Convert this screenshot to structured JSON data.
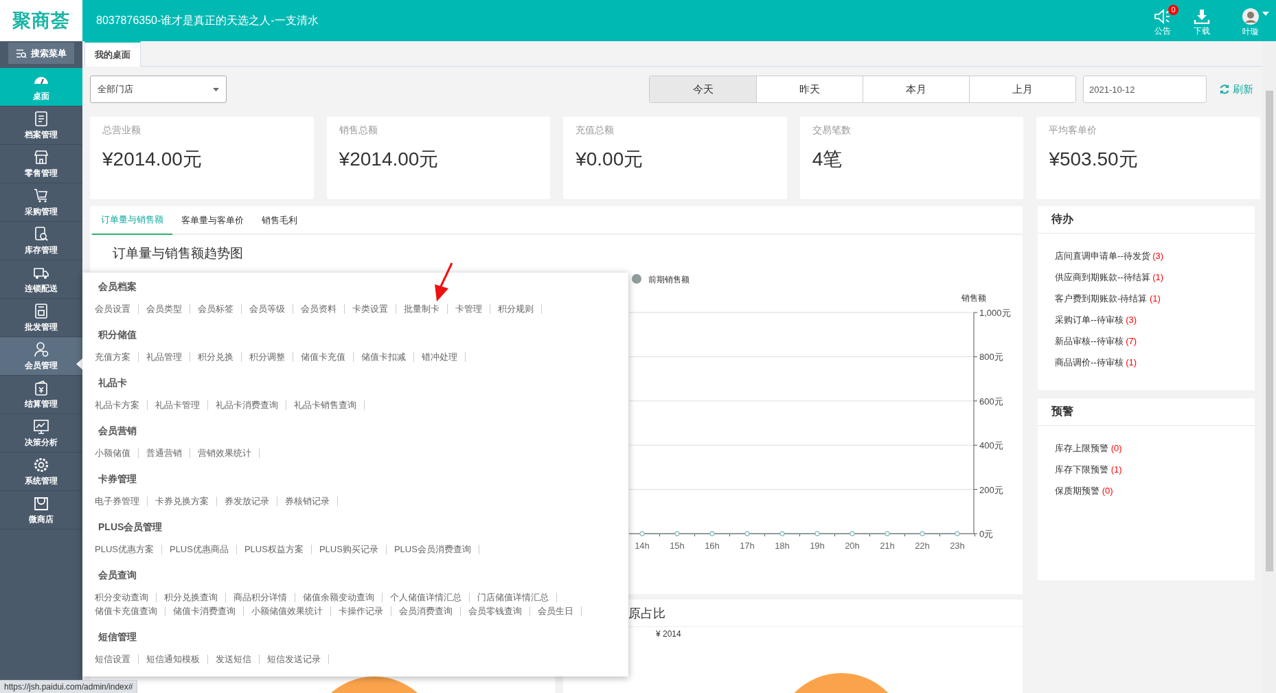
{
  "header": {
    "logo": "聚商荟",
    "title": "8037876350-谁才是真正的天选之人-一支清水",
    "actions": [
      {
        "kind": "notice",
        "label": "公告",
        "badge": "0"
      },
      {
        "kind": "download",
        "label": "下载"
      },
      {
        "kind": "user",
        "label": "叶璇"
      }
    ]
  },
  "sidebar": {
    "search": "搜索菜单",
    "items": [
      {
        "label": "桌面",
        "selected": true,
        "expanded": false
      },
      {
        "label": "档案管理",
        "selected": false,
        "expanded": false
      },
      {
        "label": "零售管理",
        "selected": false,
        "expanded": false
      },
      {
        "label": "采购管理",
        "selected": false,
        "expanded": false
      },
      {
        "label": "库存管理",
        "selected": false,
        "expanded": false
      },
      {
        "label": "连锁配送",
        "selected": false,
        "expanded": false
      },
      {
        "label": "批发管理",
        "selected": false,
        "expanded": false
      },
      {
        "label": "会员管理",
        "selected": false,
        "expanded": true
      },
      {
        "label": "结算管理",
        "selected": false,
        "expanded": false
      },
      {
        "label": "决策分析",
        "selected": false,
        "expanded": false
      },
      {
        "label": "系统管理",
        "selected": false,
        "expanded": false
      },
      {
        "label": "微商店",
        "selected": false,
        "expanded": false
      }
    ]
  },
  "page_tabs": [
    {
      "label": "我的桌面",
      "selected": true
    }
  ],
  "store_select": {
    "value": "全部门店"
  },
  "date_ranges": [
    {
      "label": "今天",
      "selected": true
    },
    {
      "label": "昨天",
      "selected": false
    },
    {
      "label": "本月",
      "selected": false
    },
    {
      "label": "上月",
      "selected": false
    }
  ],
  "date_field": {
    "value": "2021-10-12"
  },
  "refresh": "刷新",
  "stats": [
    {
      "label": "总营业额",
      "value": "¥2014.00元"
    },
    {
      "label": "销售总额",
      "value": "¥2014.00元"
    },
    {
      "label": "充值总额",
      "value": "¥0.00元"
    },
    {
      "label": "交易笔数",
      "value": "4笔"
    },
    {
      "label": "平均客单价",
      "value": "¥503.50元"
    }
  ],
  "chart_panel": {
    "tabs": [
      {
        "label": "订单量与销售额",
        "selected": true
      },
      {
        "label": "客单量与客单价",
        "selected": false
      },
      {
        "label": "销售毛利",
        "selected": false
      }
    ],
    "title": "订单量与销售额趋势图",
    "chart_data": {
      "type": "line",
      "ylabel": "销售额",
      "categories": [
        "14h",
        "15h",
        "16h",
        "17h",
        "18h",
        "19h",
        "20h",
        "21h",
        "22h",
        "23h"
      ],
      "grid": true,
      "series": [
        {
          "name": "前期销售额",
          "color": "#8d9c9c",
          "marker": "circle",
          "values": [
            0,
            0,
            0,
            0,
            0,
            0,
            0,
            0,
            0,
            0
          ]
        }
      ],
      "ylim": [
        0,
        1000
      ],
      "yticks": [
        {
          "value": 0,
          "label": "0元"
        },
        {
          "value": 200,
          "label": "200元"
        },
        {
          "value": 400,
          "label": "400元"
        },
        {
          "value": 600,
          "label": "600元"
        },
        {
          "value": 800,
          "label": "800元"
        },
        {
          "value": 1000,
          "label": "1,000元"
        }
      ]
    }
  },
  "todo": {
    "title": "待办",
    "items": [
      {
        "text": "店间直调申请单--待发货",
        "count": "(3)"
      },
      {
        "text": "供应商到期账款--待结算",
        "count": "(1)"
      },
      {
        "text": "客户费到期账款-待结算",
        "count": "(1)"
      },
      {
        "text": "采购订单--待审核",
        "count": "(3)"
      },
      {
        "text": "新品审核--待审核",
        "count": "(7)"
      },
      {
        "text": "商品调价--待审核",
        "count": "(1)"
      }
    ]
  },
  "alerts": {
    "title": "预警",
    "items": [
      {
        "text": "库存上限预警",
        "count": "(0)"
      },
      {
        "text": "库存下限预警",
        "count": "(1)"
      },
      {
        "text": "保质期预警",
        "count": "(0)"
      }
    ]
  },
  "source_panel": {
    "title": "原占比",
    "value_label": "¥ 2014"
  },
  "member_menu": {
    "groups": [
      {
        "title": "会员档案",
        "rows": [
          [
            "会员设置",
            "会员类型",
            "会员标签",
            "会员等级",
            "会员资料",
            "卡类设置",
            "批量制卡",
            "卡管理",
            "积分规则"
          ]
        ]
      },
      {
        "title": "积分储值",
        "rows": [
          [
            "充值方案",
            "礼品管理",
            "积分兑换",
            "积分调整",
            "储值卡充值",
            "储值卡扣减",
            "错冲处理"
          ]
        ]
      },
      {
        "title": "礼品卡",
        "rows": [
          [
            "礼品卡方案",
            "礼品卡管理",
            "礼品卡消费查询",
            "礼品卡销售查询"
          ]
        ]
      },
      {
        "title": "会员营销",
        "rows": [
          [
            "小额储值",
            "普通营销",
            "营销效果统计"
          ]
        ]
      },
      {
        "title": "卡券管理",
        "rows": [
          [
            "电子券管理",
            "卡券兑换方案",
            "券发放记录",
            "券核销记录"
          ]
        ]
      },
      {
        "title": "PLUS会员管理",
        "rows": [
          [
            "PLUS优惠方案",
            "PLUS优惠商品",
            "PLUS权益方案",
            "PLUS购买记录",
            "PLUS会员消费查询"
          ]
        ]
      },
      {
        "title": "会员查询",
        "rows": [
          [
            "积分变动查询",
            "积分兑换查询",
            "商品积分详情",
            "储值余额变动查询",
            "个人储值详情汇总",
            "门店储值详情汇总"
          ],
          [
            "储值卡充值查询",
            "储值卡消费查询",
            "小额储值效果统计",
            "卡操作记录",
            "会员消费查询",
            "会员零钱查询",
            "会员生日"
          ]
        ]
      },
      {
        "title": "短信管理",
        "rows": [
          [
            "短信设置",
            "短信通知模板",
            "发送短信",
            "短信发送记录"
          ]
        ]
      }
    ]
  },
  "status_url": "https://jsh.paidui.com/admin/index#"
}
